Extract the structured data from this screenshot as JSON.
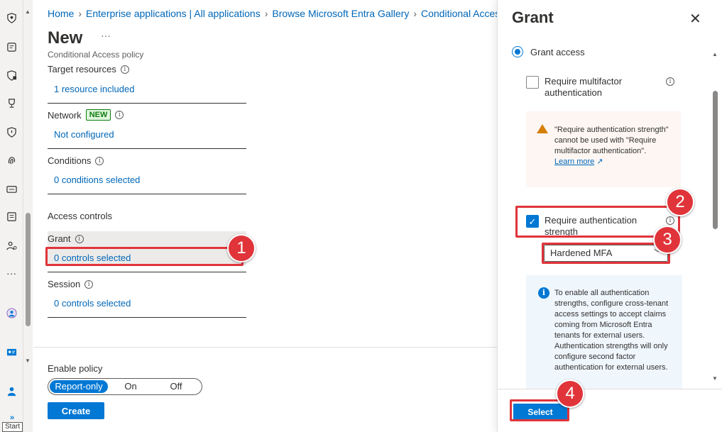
{
  "rail": {
    "icons": [
      "shield-user-icon",
      "id-card-icon",
      "lock-shield-icon",
      "trophy-icon",
      "shield-icon",
      "fingerprint-icon",
      "card-icon",
      "document-list-icon",
      "people-settings-icon",
      "more-icon",
      "user-circle-icon",
      "id-badge-icon",
      "person-icon"
    ],
    "tooltip": "Start",
    "expand": "»"
  },
  "breadcrumb": [
    "Home",
    "Enterprise applications | All applications",
    "Browse Microsoft Entra Gallery",
    "Conditional Access"
  ],
  "page": {
    "title": "New",
    "more": "···",
    "subtitle": "Conditional Access policy"
  },
  "sections": {
    "target": {
      "label": "Target resources",
      "value": "1 resource included"
    },
    "network": {
      "label": "Network",
      "badge": "NEW",
      "value": "Not configured"
    },
    "conditions": {
      "label": "Conditions",
      "value": "0 conditions selected"
    },
    "access_controls": {
      "label": "Access controls"
    },
    "grant": {
      "label": "Grant",
      "value": "0 controls selected"
    },
    "session": {
      "label": "Session",
      "value": "0 controls selected"
    }
  },
  "enable_policy": {
    "label": "Enable policy",
    "options": [
      "Report-only",
      "On",
      "Off"
    ],
    "selected": "Report-only"
  },
  "create_label": "Create",
  "panel": {
    "title": "Grant",
    "close": "✕",
    "grant_access_label": "Grant access",
    "mfa_label": "Require multifactor authentication",
    "mfa_checked": false,
    "warning_text": "\"Require authentication strength\" cannot be used with \"Require multifactor authentication\".",
    "warning_link": "Learn more",
    "auth_strength_label": "Require authentication strength",
    "auth_strength_checked": true,
    "strength_value": "Hardened MFA",
    "info_text": "To enable all authentication strengths, configure cross-tenant access settings to accept claims coming from Microsoft Entra tenants for external users. Authentication strengths will only configure second factor authentication for external users.",
    "select_label": "Select"
  },
  "callouts": [
    "1",
    "2",
    "3",
    "4"
  ],
  "colors": {
    "accent": "#0078d4",
    "callout": "#e0343a",
    "link": "#0067b8"
  }
}
